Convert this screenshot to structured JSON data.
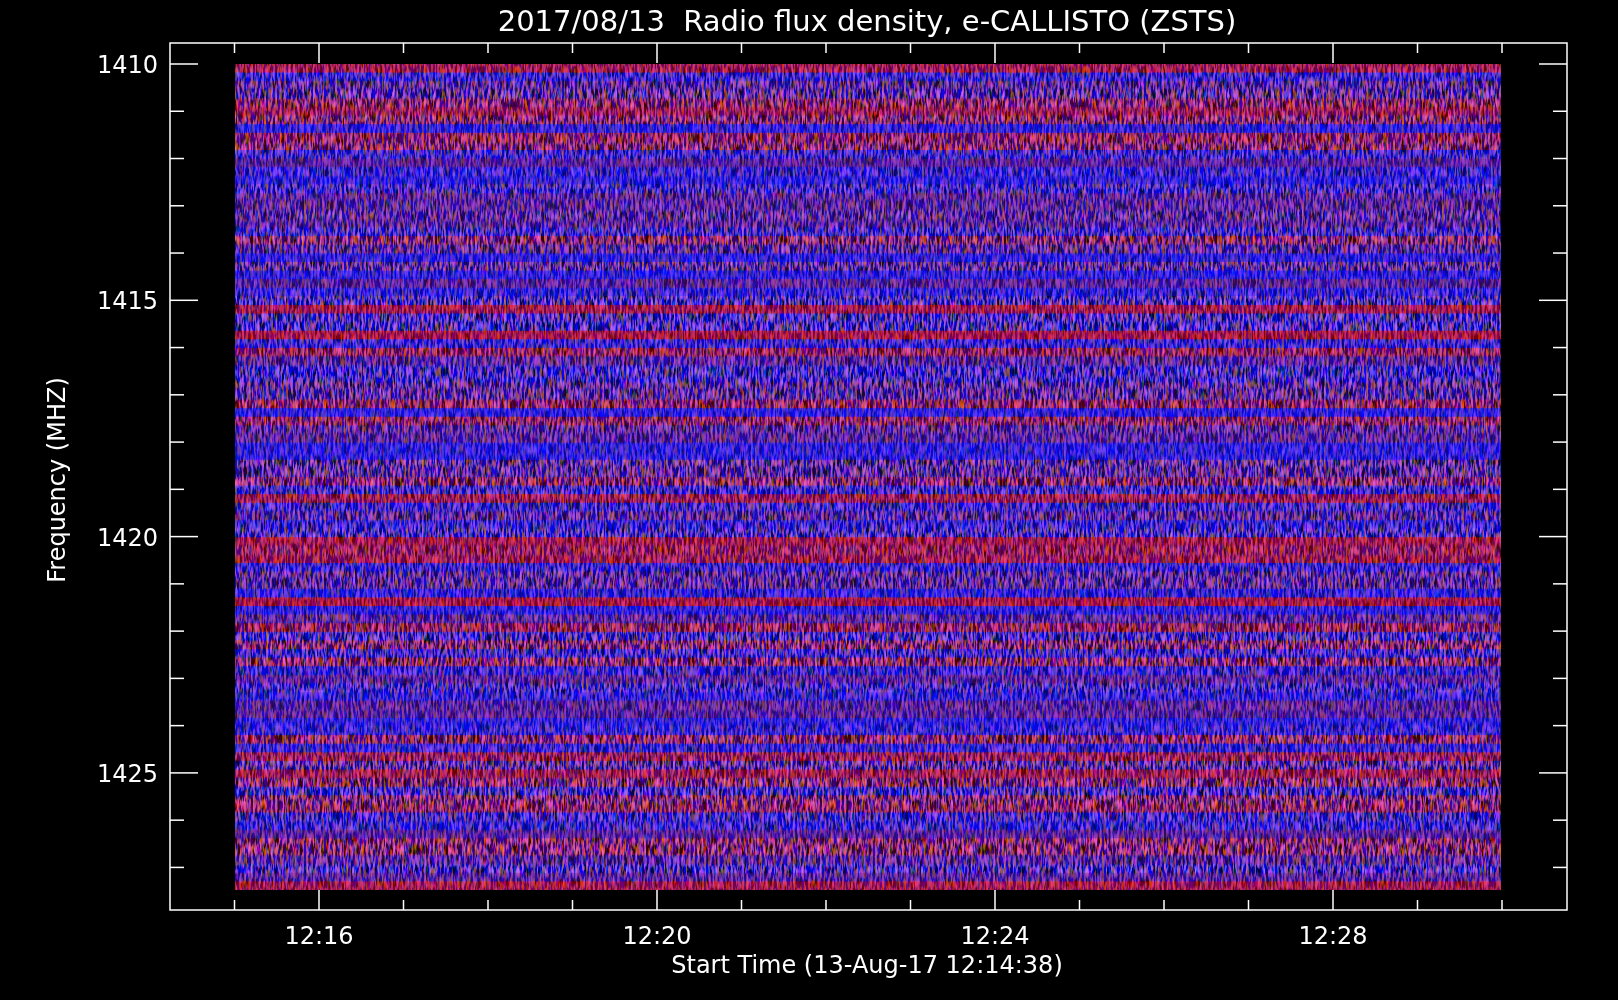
{
  "chart": {
    "title": "2017/08/13  Radio flux density, e-CALLISTO (ZSTS)",
    "y_axis": {
      "label": "Frequency (MHZ)",
      "ticks": [
        "1410",
        "1415",
        "1420",
        "1425"
      ]
    },
    "x_axis": {
      "label": "Start Time (13-Aug-17 12:14:38)",
      "ticks": [
        "12:16",
        "12:20",
        "12:24",
        "12:28"
      ]
    }
  }
}
